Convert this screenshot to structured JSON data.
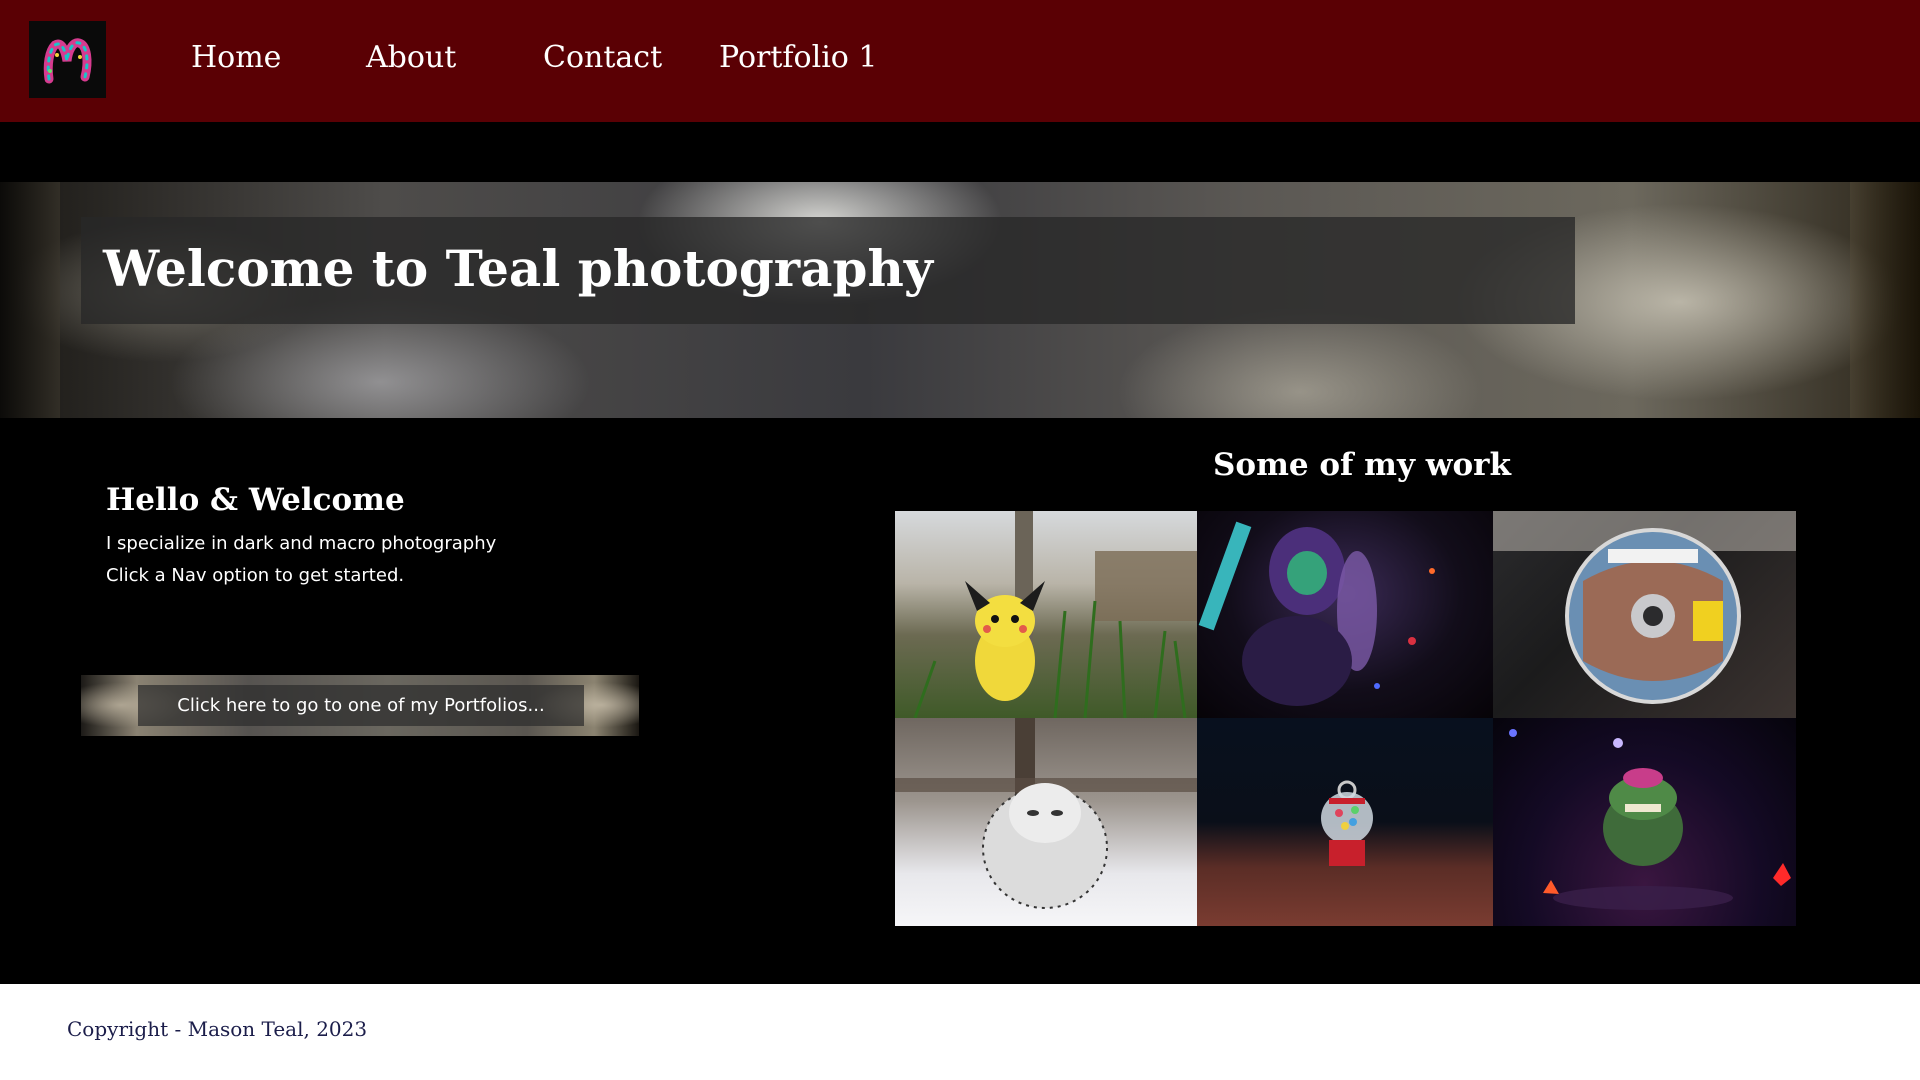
{
  "nav": {
    "logo_alt": "M",
    "links": [
      "Home",
      "About",
      "Contact",
      "Portfolio 1"
    ]
  },
  "hero": {
    "title": "Welcome to Teal photography"
  },
  "intro": {
    "heading": "Hello & Welcome",
    "lines": [
      "I specialize in dark and macro photography",
      "Click a Nav option to get started."
    ],
    "cta_label": "Click here to go to one of my Portfolios..."
  },
  "gallery": {
    "heading": "Some of my work",
    "photos": [
      {
        "subject": "pichu-figure"
      },
      {
        "subject": "armored-figure"
      },
      {
        "subject": "xbox-disc"
      },
      {
        "subject": "snowy-owl"
      },
      {
        "subject": "gumball-keychain"
      },
      {
        "subject": "crocodile-figure"
      }
    ]
  },
  "footer": {
    "copyright": "Copyright - Mason Teal, 2023"
  },
  "colors": {
    "nav_bg": "#5a0004",
    "page_bg": "#000000",
    "footer_bg": "#ffffff",
    "footer_text": "#1b1d4a"
  }
}
